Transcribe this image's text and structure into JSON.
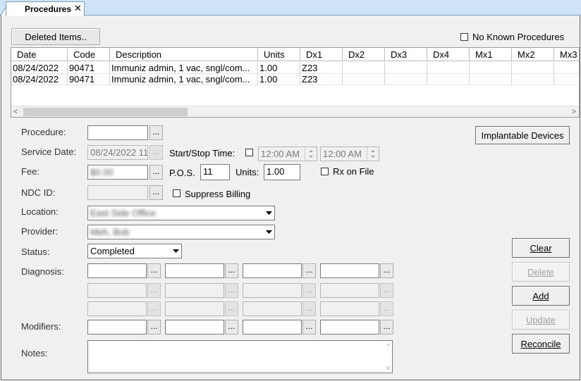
{
  "tab": {
    "label": "Procedures",
    "close": "✕"
  },
  "toolbar": {
    "deleted_items": "Deleted Items.."
  },
  "no_known": {
    "label": "No Known Procedures"
  },
  "grid": {
    "headers": [
      "Date",
      "Code",
      "Description",
      "Units",
      "Dx1",
      "Dx2",
      "Dx3",
      "Dx4",
      "Mx1",
      "Mx2",
      "Mx3"
    ],
    "rows": [
      [
        "08/24/2022",
        "90471",
        "Immuniz admin, 1 vac, sngl/com...",
        "1.00",
        "Z23",
        "",
        "",
        "",
        "",
        "",
        ""
      ],
      [
        "08/24/2022",
        "90471",
        "Immuniz admin, 1 vac, sngl/com...",
        "1.00",
        "Z23",
        "",
        "",
        "",
        "",
        "",
        ""
      ]
    ]
  },
  "form": {
    "procedure_label": "Procedure:",
    "service_date_label": "Service Date:",
    "service_date_value": "08/24/2022 11",
    "start_stop_label": "Start/Stop Time:",
    "start_time": "12:00 AM",
    "stop_time": "12:00 AM",
    "fee_label": "Fee:",
    "fee_value": "$0.00",
    "pos_label": "P.O.S.",
    "pos_value": "11",
    "units_label": "Units:",
    "units_value": "1.00",
    "rx_on_file": "Rx on File",
    "ndc_label": "NDC ID:",
    "suppress_billing": "Suppress Billing",
    "location_label": "Location:",
    "location_value": "East Side Office",
    "provider_label": "Provider:",
    "provider_value": "Meh, Bob",
    "status_label": "Status:",
    "status_value": "Completed",
    "diagnosis_label": "Diagnosis:",
    "modifiers_label": "Modifiers:",
    "notes_label": "Notes:",
    "ellipsis": "..."
  },
  "buttons": {
    "implantable": "Implantable Devices",
    "clear": "Clear",
    "delete": "Delete",
    "add": "Add",
    "update": "Update",
    "reconcile": "Reconcile"
  },
  "scroll": {
    "left": "<",
    "right": ">",
    "up": "^",
    "down": "v"
  }
}
